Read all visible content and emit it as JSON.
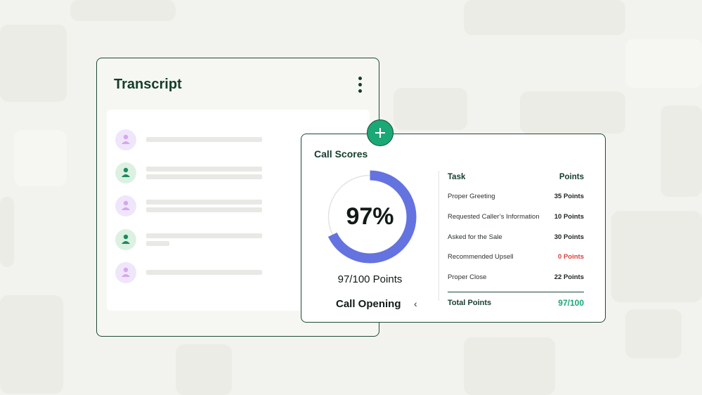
{
  "transcript": {
    "title": "Transcript",
    "rows": [
      {
        "speaker": "purple"
      },
      {
        "speaker": "green"
      },
      {
        "speaker": "purple"
      },
      {
        "speaker": "green"
      },
      {
        "speaker": "purple"
      }
    ]
  },
  "call_scores": {
    "title": "Call Scores",
    "score_percent": "97%",
    "score_fraction": 0.97,
    "points_summary": "97/100 Points",
    "section": "Call Opening",
    "table": {
      "header_task": "Task",
      "header_points": "Points",
      "rows": [
        {
          "task": "Proper Greeting",
          "points": "35 Points"
        },
        {
          "task": "Requested Caller’s Information",
          "points": "10 Points"
        },
        {
          "task": "Asked for the Sale",
          "points": "30 Points"
        },
        {
          "task": "Recommended Upsell",
          "points": "0 Points"
        },
        {
          "task": "Proper Close",
          "points": "22 Points"
        }
      ],
      "total_label": "Total Points",
      "total_value": "97/100"
    }
  },
  "colors": {
    "brand_dark": "#143d2c",
    "accent_green": "#1aa876",
    "donut_blue": "#6473e0",
    "zero_red": "#d6403b"
  }
}
